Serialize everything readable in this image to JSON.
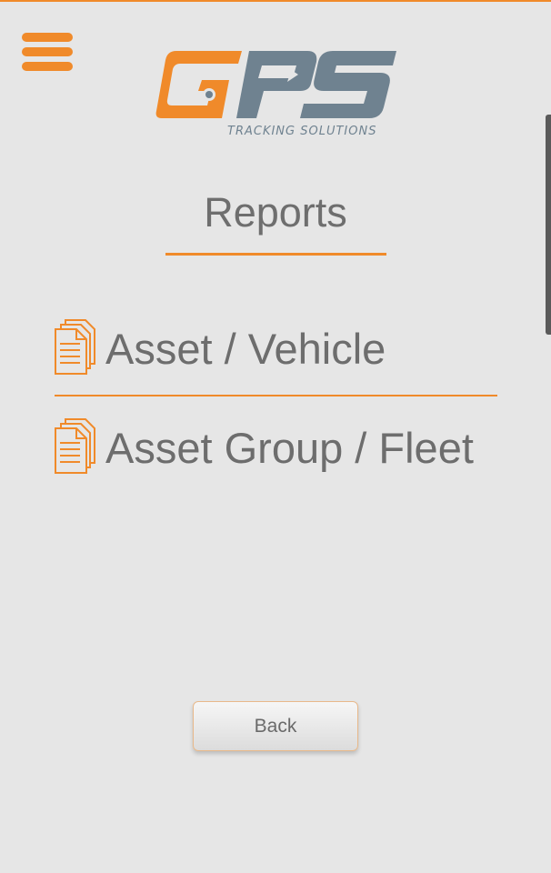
{
  "header": {
    "menu_icon": "hamburger-menu-icon",
    "logo": {
      "text": "GPS",
      "tagline": "TRACKING SOLUTIONS"
    }
  },
  "main": {
    "title": "Reports",
    "items": [
      {
        "label": "Asset / Vehicle",
        "icon": "documents-icon"
      },
      {
        "label": "Asset Group / Fleet",
        "icon": "documents-icon"
      }
    ],
    "back_label": "Back"
  },
  "colors": {
    "accent": "#f08a2a",
    "logo_secondary": "#6f8290",
    "background": "#e6e6e6",
    "text": "#6d6d6d"
  }
}
